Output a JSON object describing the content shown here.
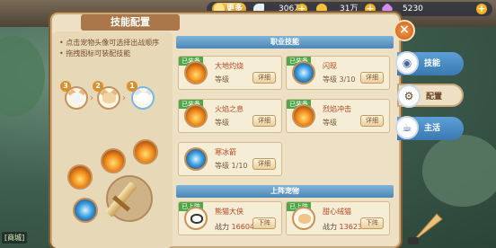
{
  "window": {
    "title": "技能配置"
  },
  "currency": {
    "more_label": "更多",
    "items": [
      {
        "icon": "feather-icon",
        "value": "306万",
        "color": "#e8eef8"
      },
      {
        "icon": "coin-icon",
        "value": "31万",
        "color": "#f3c23a"
      },
      {
        "icon": "gem-icon",
        "value": "5230",
        "color": "#d58cf0"
      }
    ]
  },
  "hints": [
    "• 点击宠物头像可选择出战顺序",
    "• 拖拽图标可装配技能"
  ],
  "order_numbers": [
    "3",
    "2",
    "1"
  ],
  "sections": {
    "skills": "职业技能",
    "pets": "上阵宠物"
  },
  "skills": [
    {
      "badge": "已装备",
      "name": "大地灼烧",
      "level": "等级",
      "button": "详细",
      "element": "fire"
    },
    {
      "badge": "已装备",
      "name": "闪现",
      "level": "等级 3/10",
      "button": "详细",
      "element": "ice"
    },
    {
      "badge": "已装备",
      "name": "火焰之息",
      "level": "等级",
      "button": "详细",
      "element": "fire"
    },
    {
      "badge": "已装备",
      "name": "烈焰冲击",
      "level": "等级",
      "button": "详细",
      "element": "fire"
    },
    {
      "badge": "",
      "name": "寒冰箭",
      "level": "等级 1/10",
      "button": "详细",
      "element": "ice"
    }
  ],
  "pets": [
    {
      "badge": "已上阵",
      "name": "熊猫大侠",
      "power_label": "战力",
      "power": "16604",
      "button": "下阵"
    },
    {
      "badge": "已上阵",
      "name": "甜心绒猫",
      "power_label": "战力",
      "power": "13623",
      "button": "下阵"
    }
  ],
  "tabs": [
    {
      "label": "技能",
      "icon": "planet-icon",
      "selected": false
    },
    {
      "label": "配置",
      "icon": "gear-icon",
      "selected": true
    },
    {
      "label": "主活",
      "icon": "cup-icon",
      "selected": false
    }
  ],
  "chat": {
    "label": "[商城]"
  },
  "accent_colors": {
    "panel": "#ede0c4",
    "section": "#4e87b6",
    "equipped": "#4ea84a"
  }
}
